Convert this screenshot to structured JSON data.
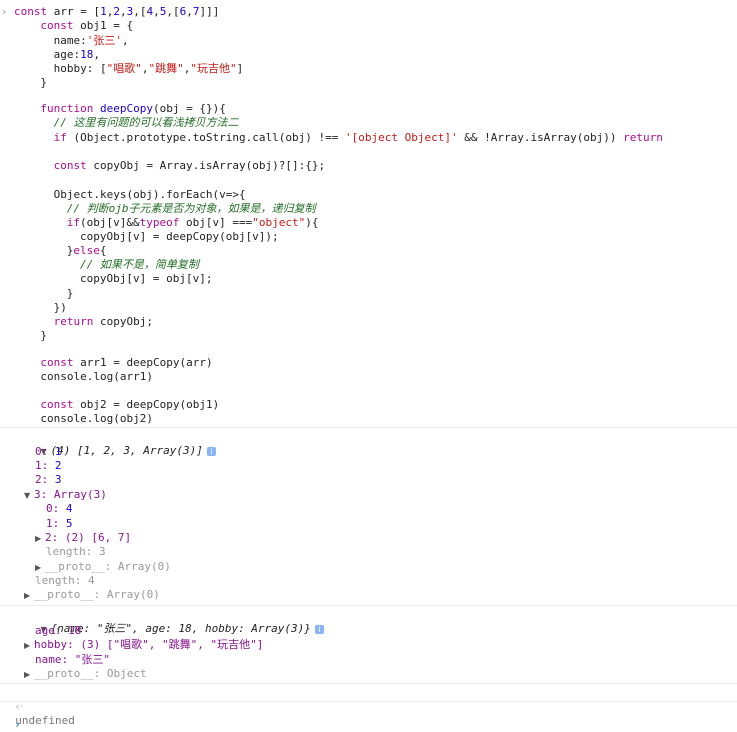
{
  "input": {
    "lines": [
      "const arr = [1,2,3,[4,5,[6,7]]]",
      "const obj1 = {",
      "name:'张三',",
      "age:18,",
      "hobby: [\"唱歌\",\"跳舞\",\"玩吉他\"]",
      "}",
      "",
      "function deepCopy(obj = {}){",
      "// 这里有问题的可以看浅拷贝方法二",
      "if (Object.prototype.toString.call(obj) !== '[object Object]' && !Array.isArray(obj)) return",
      "",
      "const copyObj = Array.isArray(obj)?[]:{};",
      "",
      "Object.keys(obj).forEach(v=>{",
      "// 判断ojb子元素是否为对象，如果是，递归复制",
      "if(obj[v]&&typeof obj[v] ===\"object\"){",
      "copyObj[v] = deepCopy(obj[v]);",
      "}else{",
      "// 如果不是，简单复制",
      "copyObj[v] = obj[v];",
      "}",
      "})",
      "return copyObj;",
      "}",
      "",
      "const arr1 = deepCopy(arr)",
      "console.log(arr1)",
      "",
      "const obj2 = deepCopy(obj1)",
      "console.log(obj2)"
    ]
  },
  "output_array": {
    "summary": "(4) [1, 2, 3, Array(3)]",
    "items": [
      {
        "key": "0",
        "value": "1"
      },
      {
        "key": "1",
        "value": "2"
      },
      {
        "key": "2",
        "value": "3"
      }
    ],
    "nested_label": "3: Array(3)",
    "nested_items": [
      {
        "key": "0",
        "value": "4"
      },
      {
        "key": "1",
        "value": "5"
      }
    ],
    "nested_child": "2: (2) [6, 7]",
    "nested_length": "length: 3",
    "nested_proto": "__proto__: Array(0)",
    "length": "length: 4",
    "proto": "__proto__: Array(0)"
  },
  "output_object": {
    "summary": "{name: \"张三\", age: 18, hobby: Array(3)}",
    "age": "age: 18",
    "hobby": "hobby: (3) [\"唱歌\", \"跳舞\", \"玩吉他\"]",
    "name": "name: \"张三\"",
    "proto": "__proto__: Object"
  },
  "result": "undefined",
  "colors": {
    "keyword": "#aa0d91",
    "string": "#c41a16",
    "number": "#1c00cf",
    "comment": "#236e25",
    "info_badge": "#8ab4f8",
    "prompt": "#1a73e8"
  }
}
